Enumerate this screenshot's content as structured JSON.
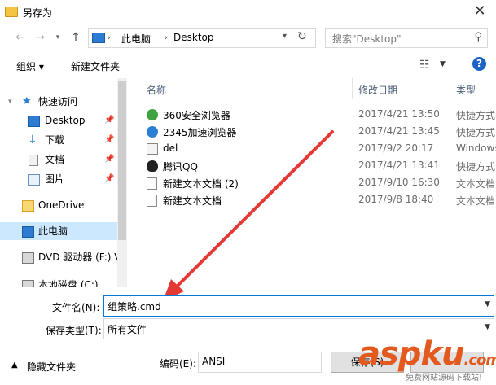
{
  "window": {
    "title": "另存为"
  },
  "address": {
    "segments": [
      "此电脑",
      "Desktop"
    ],
    "search_placeholder": "搜索\"Desktop\""
  },
  "toolbar": {
    "organize": "组织 ▾",
    "new_folder": "新建文件夹",
    "help": "?"
  },
  "nav": {
    "quick_access": "快速访问",
    "items": [
      "Desktop",
      "下载",
      "文档",
      "图片"
    ],
    "onedrive": "OneDrive",
    "this_pc": "此电脑",
    "dvd": "DVD 驱动器 (F:) V",
    "local_disk": "本地磁盘 (C:)"
  },
  "columns": {
    "name": "名称",
    "date": "修改日期",
    "type": "类型"
  },
  "files": [
    {
      "name": "360安全浏览器",
      "date": "2017/4/21 13:50",
      "type": "快捷方式",
      "icon": "360-browser-icon"
    },
    {
      "name": "2345加速浏览器",
      "date": "2017/4/21 13:45",
      "type": "快捷方式",
      "icon": "2345-browser-icon"
    },
    {
      "name": "del",
      "date": "2017/9/2 20:17",
      "type": "Windows",
      "icon": "cmd-file-icon"
    },
    {
      "name": "腾讯QQ",
      "date": "2017/4/21 13:41",
      "type": "快捷方式",
      "icon": "qq-icon"
    },
    {
      "name": "新建文本文档 (2)",
      "date": "2017/9/10 16:30",
      "type": "文本文档",
      "icon": "text-file-icon"
    },
    {
      "name": "新建文本文档",
      "date": "2017/9/8 18:40",
      "type": "文本文档",
      "icon": "text-file-icon"
    }
  ],
  "form": {
    "filename_label": "文件名(N):",
    "filename_value": "组策略.cmd",
    "type_label": "保存类型(T):",
    "type_value": "所有文件",
    "hide_folders": "隐藏文件夹",
    "encoding_label": "编码(E):",
    "encoding_value": "ANSI",
    "save_button": "保存(S)"
  },
  "watermark": {
    "brand_a": "asp",
    "brand_b": "ku",
    "brand_c": ".com",
    "sub": "免费网站源码下载站!"
  },
  "colors": {
    "accent": "#0078d7",
    "arrow": "#e53935",
    "selection": "#cce8ff"
  }
}
